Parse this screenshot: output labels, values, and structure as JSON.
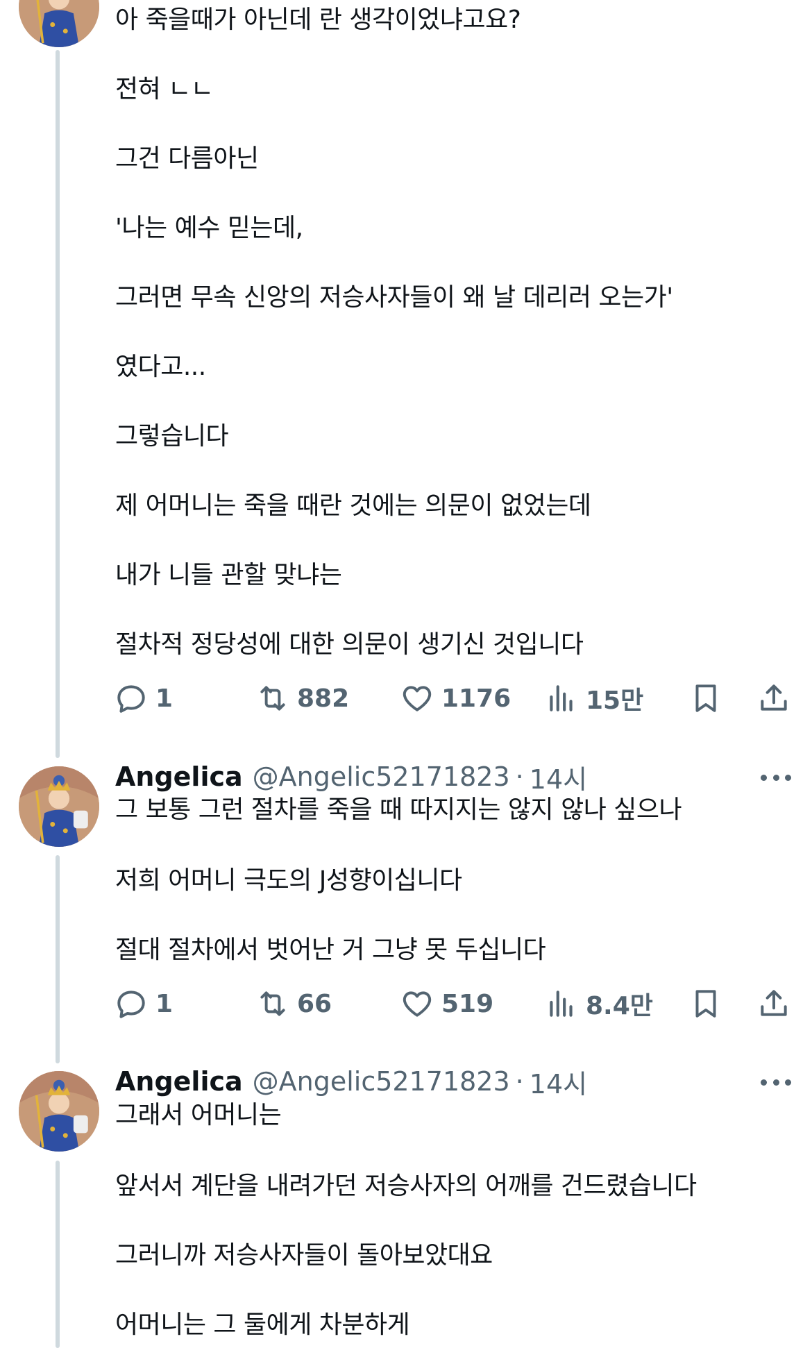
{
  "tweets": [
    {
      "lines": [
        "아 죽을때가 아닌데 란 생각이었냐고요?",
        "전혀 ㄴㄴ",
        "그건 다름아닌",
        "'나는 예수 믿는데,",
        "그러면 무속 신앙의 저승사자들이 왜 날 데리러 오는가'",
        "였다고...",
        "그렇습니다",
        "제 어머니는 죽을 때란 것에는 의문이 없었는데",
        "내가 니들 관할 맞냐는",
        "절차적 정당성에 대한 의문이 생기신 것입니다"
      ],
      "replies": "1",
      "retweets": "882",
      "likes": "1176",
      "views": "15만"
    },
    {
      "name": "Angelica",
      "handle": "@Angelic52171823",
      "dot": "·",
      "time": "14시",
      "lines": [
        "그 보통 그런 절차를 죽을 때 따지지는 않지 않나 싶으나",
        "저희 어머니 극도의 J성향이십니다",
        "절대 절차에서 벗어난 거 그냥 못 두십니다"
      ],
      "replies": "1",
      "retweets": "66",
      "likes": "519",
      "views": "8.4만"
    },
    {
      "name": "Angelica",
      "handle": "@Angelic52171823",
      "dot": "·",
      "time": "14시",
      "lines": [
        "그래서 어머니는",
        "앞서서 계단을 내려가던 저승사자의 어깨를 건드렸습니다",
        "그러니까 저승사자들이 돌아보았대요",
        "어머니는 그 둘에게 차분하게"
      ]
    }
  ],
  "icons": {
    "reply": "reply-icon",
    "retweet": "retweet-icon",
    "like": "heart-icon",
    "views": "views-icon",
    "bookmark": "bookmark-icon",
    "share": "share-icon",
    "more": "more-icon"
  },
  "colors": {
    "text": "#0f1419",
    "secondary": "#536471",
    "thread_line": "#cfd9de"
  }
}
